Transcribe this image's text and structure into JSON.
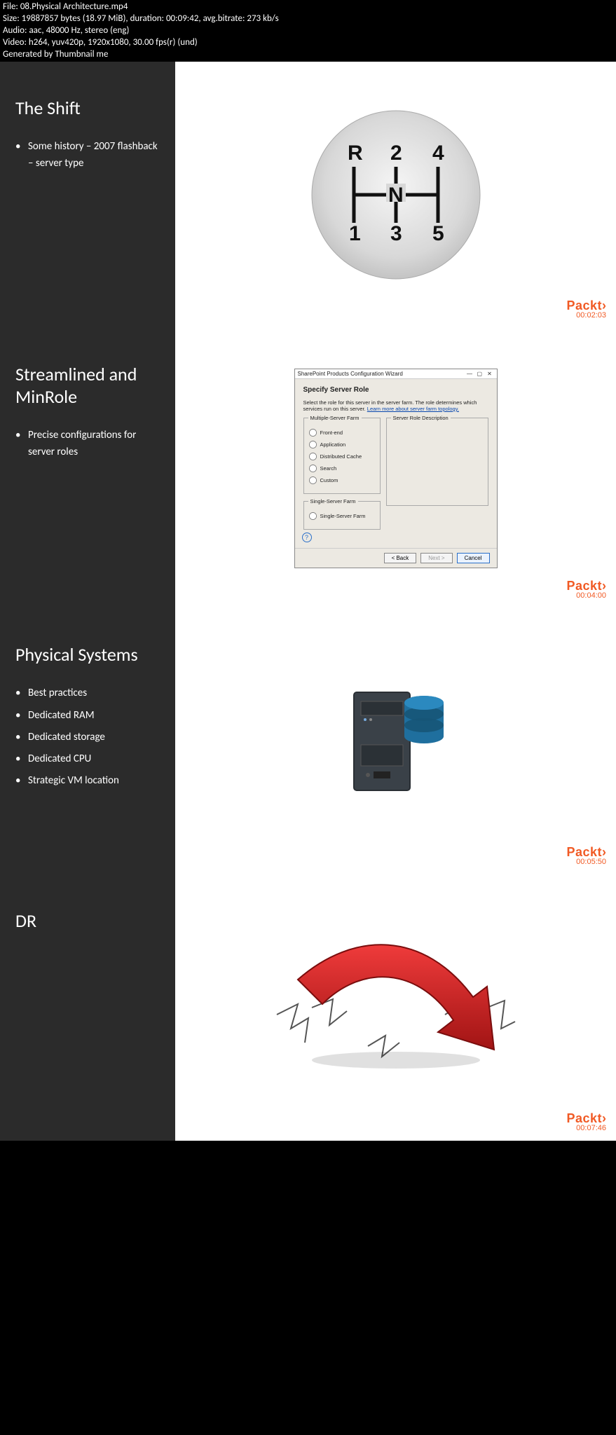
{
  "meta": {
    "file": "File: 08.Physical Architecture.mp4",
    "size": "Size: 19887857 bytes (18.97 MiB), duration: 00:09:42, avg.bitrate: 273 kb/s",
    "audio": "Audio: aac, 48000 Hz, stereo (eng)",
    "video": "Video: h264, yuv420p, 1920x1080, 30.00 fps(r) (und)",
    "gen": "Generated by Thumbnail me"
  },
  "brand": "Packt",
  "brand_caret": "›",
  "slides": [
    {
      "title": "The Shift",
      "bullets": [
        "Some history – 2007 flashback – server type"
      ],
      "timestamp": "00:02:03",
      "shifter_labels": {
        "R": "R",
        "N": "N",
        "1": "1",
        "2": "2",
        "3": "3",
        "4": "4",
        "5": "5"
      }
    },
    {
      "title": "Streamlined and MinRole",
      "bullets": [
        "Precise configurations for server roles"
      ],
      "timestamp": "00:04:00",
      "wizard": {
        "window_title": "SharePoint Products Configuration Wizard",
        "heading": "Specify Server Role",
        "desc_pre": "Select the role for this server in the server farm. The role determines which services run on this server. ",
        "desc_link": "Learn more about server farm topology.",
        "group_multi": "Multiple-Server Farm",
        "group_single": "Single-Server Farm",
        "group_desc": "Server Role Description",
        "options_multi": [
          "Front-end",
          "Application",
          "Distributed Cache",
          "Search",
          "Custom"
        ],
        "options_single": [
          "Single-Server Farm"
        ],
        "btn_back": "< Back",
        "btn_next": "Next >",
        "btn_cancel": "Cancel"
      }
    },
    {
      "title": "Physical Systems",
      "bullets": [
        "Best practices",
        "Dedicated RAM",
        "Dedicated storage",
        "Dedicated CPU",
        "Strategic VM location"
      ],
      "timestamp": "00:05:50"
    },
    {
      "title": "DR",
      "bullets": [],
      "timestamp": "00:07:46"
    }
  ]
}
